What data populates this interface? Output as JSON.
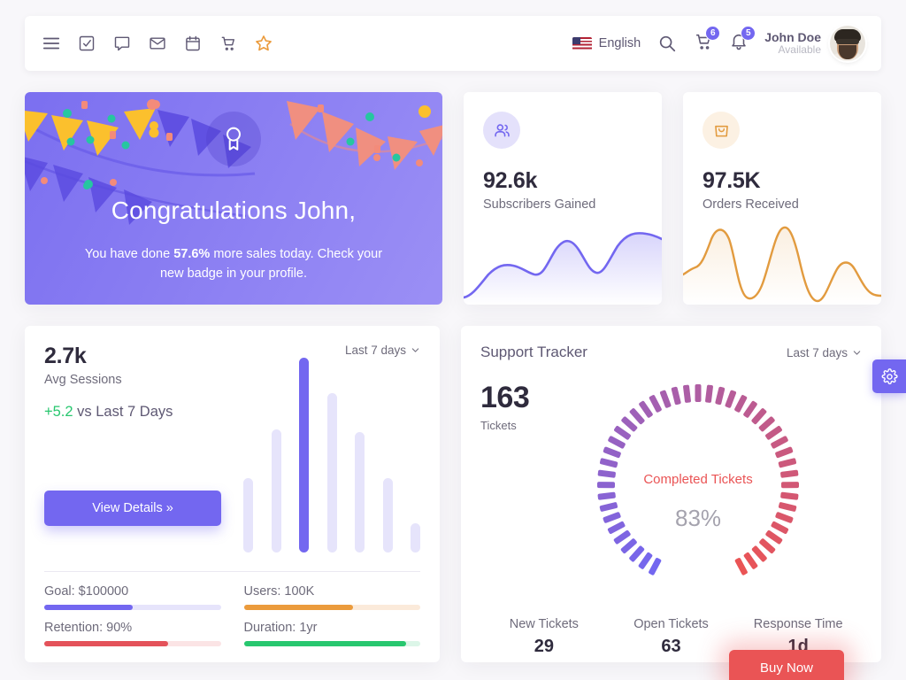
{
  "navbar": {
    "left_icons": [
      "menu-icon",
      "task-check-icon",
      "chat-icon",
      "email-icon",
      "calendar-icon",
      "cart-icon",
      "star-icon"
    ],
    "language": "English",
    "flag": "us-flag-icon",
    "search_icon": "search-icon",
    "cart_badge": "6",
    "bell_badge": "5",
    "user_name": "John Doe",
    "user_status": "Available"
  },
  "congrats": {
    "title": "Congratulations John,",
    "text_before": "You have done ",
    "highlight": "57.6%",
    "text_after": " more sales today. Check your new badge in your profile.",
    "icon": "award-badge-icon"
  },
  "stats": [
    {
      "value": "92.6k",
      "label": "Subscribers Gained",
      "icon": "users-icon",
      "accent": "#7367f0",
      "icon_bg": "#e4e1fb"
    },
    {
      "value": "97.5K",
      "label": "Orders Received",
      "icon": "shopping-bag-icon",
      "accent": "#e29b3f",
      "icon_bg": "#fcf1e3"
    }
  ],
  "sessions": {
    "value": "2.7k",
    "label": "Avg Sessions",
    "delta": "+5.2",
    "delta_suffix": " vs Last 7 Days",
    "button_label": "View Details  »",
    "dropdown": "Last 7 days",
    "progress": [
      {
        "label": "Goal: $100000",
        "percent": 50,
        "color": "#7367f0",
        "track": "#e6e4fb"
      },
      {
        "label": "Users: 100K",
        "percent": 62,
        "color": "#eb9b3c",
        "track": "#fbeada"
      },
      {
        "label": "Retention: 90%",
        "percent": 70,
        "color": "#e4525a",
        "track": "#fbe4e5"
      },
      {
        "label": "Duration: 1yr",
        "percent": 92,
        "color": "#28c76f",
        "track": "#dcf6e8"
      }
    ]
  },
  "support": {
    "title": "Support Tracker",
    "dropdown": "Last 7 days",
    "value": "163",
    "label": "Tickets",
    "gauge_caption": "Completed Tickets",
    "gauge_percent": "83%",
    "stats": [
      {
        "label": "New Tickets",
        "value": "29"
      },
      {
        "label": "Open Tickets",
        "value": "63"
      },
      {
        "label": "Response Time",
        "value": "1d"
      }
    ]
  },
  "floating": {
    "gear_icon": "gear-icon",
    "buy_now_label": "Buy Now"
  },
  "chart_data": [
    {
      "type": "area",
      "title": "Subscribers Gained",
      "x": [
        0,
        1,
        2,
        3,
        4,
        5,
        6,
        7,
        8,
        9
      ],
      "values": [
        8,
        26,
        38,
        33,
        30,
        58,
        42,
        28,
        74,
        66
      ],
      "color": "#7367f0",
      "grid": false,
      "legend": "none"
    },
    {
      "type": "line",
      "title": "Orders Received",
      "x": [
        0,
        1,
        2,
        3,
        4,
        5,
        6,
        7,
        8,
        9,
        10
      ],
      "values": [
        30,
        18,
        76,
        8,
        22,
        76,
        20,
        4,
        26,
        56,
        22
      ],
      "color": "#e29b3f",
      "grid": false,
      "legend": "none"
    },
    {
      "type": "bar",
      "title": "Avg Sessions",
      "categories": [
        "1",
        "2",
        "3",
        "4",
        "5",
        "6",
        "7"
      ],
      "values": [
        38,
        63,
        100,
        82,
        62,
        38,
        15
      ],
      "highlight_index": 2,
      "ylim": [
        0,
        100
      ],
      "grid": false,
      "legend": "none"
    },
    {
      "type": "gauge",
      "title": "Completed Tickets",
      "values": [
        83
      ],
      "ylim": [
        0,
        100
      ],
      "start_color": "#7367f0",
      "end_color": "#ea5455",
      "ticks": 45,
      "legend": "none"
    }
  ]
}
